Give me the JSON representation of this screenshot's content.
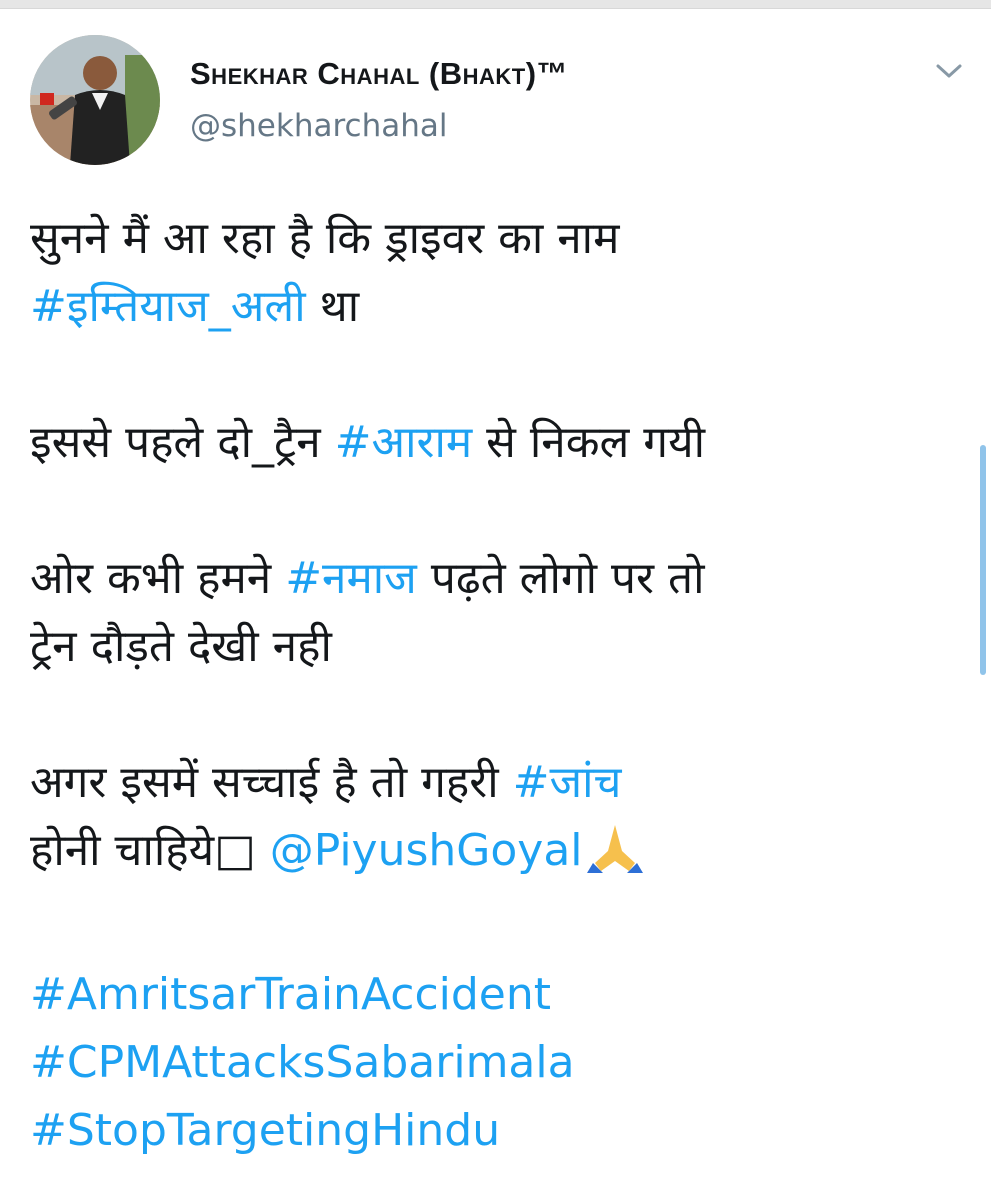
{
  "header": {
    "display_name": "Shekhar Chahal (Bhakt)™",
    "handle": "@shekharchahal",
    "avatar_icon": "user-photo",
    "menu_icon": "chevron-down-icon"
  },
  "tweet": {
    "p1": {
      "t1": "सुनने मैं आ रहा है कि ड्राइवर का नाम",
      "tag1": "#इम्तियाज_अली",
      "t2": " था"
    },
    "p2": {
      "t1": "इससे पहले दो_ट्रैन ",
      "tag1": "#आराम",
      "t2": " से निकल गयी"
    },
    "p3": {
      "t1": "ओर कभी हमने ",
      "tag1": "#नमाज",
      "t2": " पढ़ते लोगो पर तो",
      "t3": "ट्रेन दौड़ते देखी नही"
    },
    "p4": {
      "t1": "अगर इसमें सच्चाई है तो गहरी ",
      "tag1": "#जांच",
      "t2": "होनी चाहिये",
      "missing_glyph": "□",
      "mention": " @PiyushGoyal",
      "emoji": "folded-hands"
    },
    "hashtags": [
      "#AmritsarTrainAccident",
      "#CPMAttacksSabarimala",
      "#StopTargetingHindu"
    ]
  },
  "colors": {
    "link": "#1da1f2",
    "text": "#14171a",
    "secondary": "#657786",
    "scrollbar": "#90c4ea"
  }
}
